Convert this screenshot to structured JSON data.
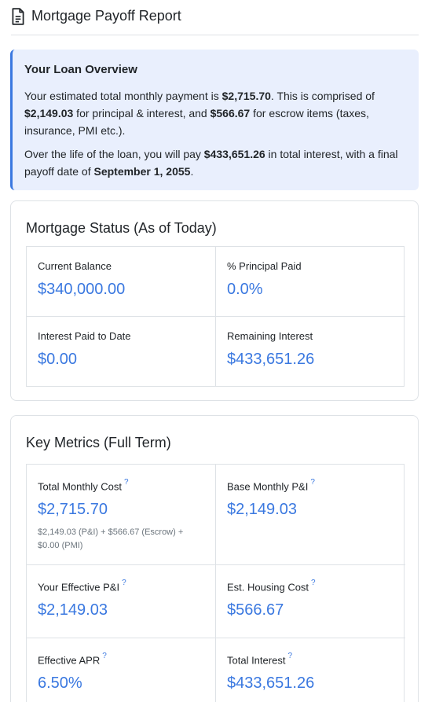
{
  "header": {
    "title": "Mortgage Payoff Report",
    "icon": "document-icon"
  },
  "overview": {
    "title": "Your Loan Overview",
    "p1": {
      "t1": "Your estimated total monthly payment is ",
      "b1": "$2,715.70",
      "t2": ". This is comprised of ",
      "b2": "$2,149.03",
      "t3": " for principal & interest, and ",
      "b3": "$566.67",
      "t4": " for escrow items (taxes, insurance, PMI etc.)."
    },
    "p2": {
      "t1": "Over the life of the loan, you will pay ",
      "b1": "$433,651.26",
      "t2": " in total interest, with a final payoff date of ",
      "b2": "September 1, 2055",
      "t3": "."
    }
  },
  "status": {
    "title": "Mortgage Status (As of Today)",
    "items": [
      {
        "label": "Current Balance",
        "value": "$340,000.00"
      },
      {
        "label": "% Principal Paid",
        "value": "0.0%"
      },
      {
        "label": "Interest Paid to Date",
        "value": "$0.00"
      },
      {
        "label": "Remaining Interest",
        "value": "$433,651.26"
      }
    ]
  },
  "metrics": {
    "title": "Key Metrics (Full Term)",
    "help_mark": "?",
    "items": [
      {
        "label": "Total Monthly Cost",
        "value": "$2,715.70",
        "note": "$2,149.03 (P&I) + $566.67 (Escrow) + $0.00 (PMI)"
      },
      {
        "label": "Base Monthly P&I",
        "value": "$2,149.03"
      },
      {
        "label": "Your Effective P&I",
        "value": "$2,149.03"
      },
      {
        "label": "Est. Housing Cost",
        "value": "$566.67"
      },
      {
        "label": "Effective APR",
        "value": "6.50%"
      },
      {
        "label": "Total Interest",
        "value": "$433,651.26"
      }
    ]
  },
  "colors": {
    "accent": "#3a78e0",
    "overview_bg": "#e9effd",
    "border": "#dee2e6"
  }
}
